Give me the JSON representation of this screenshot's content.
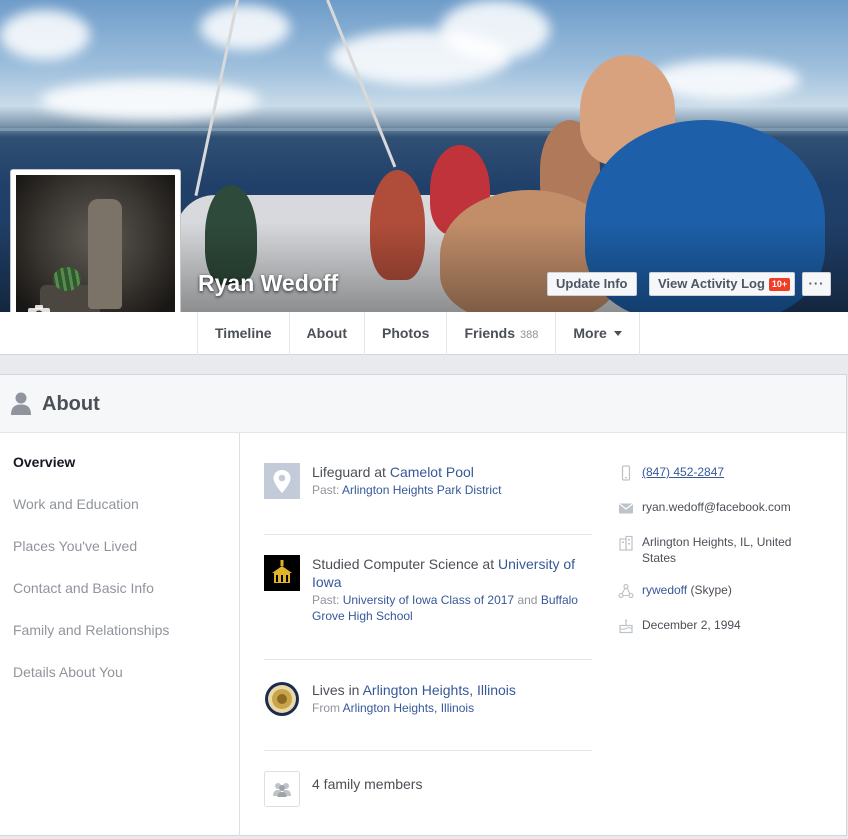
{
  "profile": {
    "name": "Ryan Wedoff"
  },
  "cover_actions": {
    "update_info": "Update Info",
    "view_activity_log": "View Activity Log",
    "activity_badge": "10+",
    "more": "···"
  },
  "nav": {
    "tabs": [
      {
        "label": "Timeline"
      },
      {
        "label": "About"
      },
      {
        "label": "Photos"
      },
      {
        "label": "Friends",
        "count": "388"
      },
      {
        "label": "More"
      }
    ]
  },
  "about": {
    "title": "About",
    "sections": [
      {
        "label": "Overview",
        "active": true
      },
      {
        "label": "Work and Education"
      },
      {
        "label": "Places You've Lived"
      },
      {
        "label": "Contact and Basic Info"
      },
      {
        "label": "Family and Relationships"
      },
      {
        "label": "Details About You"
      }
    ],
    "work": {
      "prefix": "Lifeguard at ",
      "place": "Camelot Pool",
      "past_prefix": "Past: ",
      "past": "Arlington Heights Park District"
    },
    "education": {
      "prefix": "Studied Computer Science at ",
      "school": "University of Iowa",
      "past_prefix": "Past: ",
      "past1": "University of Iowa Class of 2017",
      "and": " and ",
      "past2": "Buffalo Grove High School"
    },
    "lives": {
      "prefix": "Lives in ",
      "city": "Arlington Heights, Illinois",
      "from_prefix": "From ",
      "from": "Arlington Heights, Illinois"
    },
    "family": {
      "text": "4 family members"
    },
    "contact": {
      "phone": "(847) 452-2847",
      "email": "ryan.wedoff@facebook.com",
      "address": "Arlington Heights, IL, United States",
      "skype_name": "rywedoff",
      "skype_label": " (Skype)",
      "birthday": "December 2, 1994"
    }
  },
  "colors": {
    "link": "#365899",
    "nav_text": "#4b4f56",
    "muted": "#90949c",
    "badge": "#f03d25",
    "page_bg": "#e9eaed"
  }
}
